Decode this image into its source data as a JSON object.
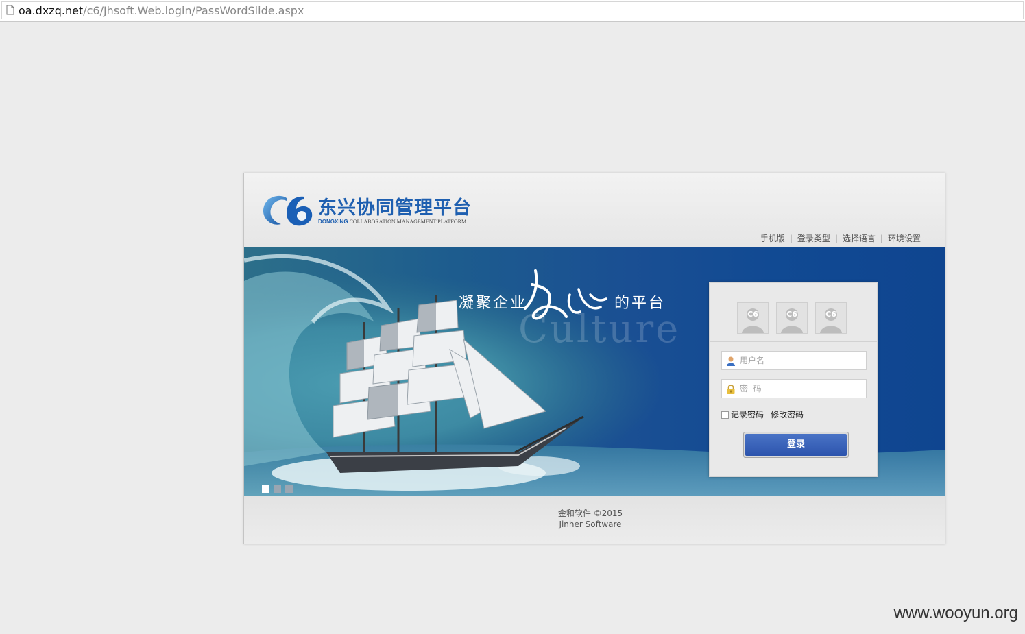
{
  "browser": {
    "url_host": "oa.dxzq.net",
    "url_path": "/c6/Jhsoft.Web.login/PassWordSlide.aspx"
  },
  "brand": {
    "logo_text": "C6",
    "title": "东兴协同管理平台",
    "subtitle_lead": "DONGXING",
    "subtitle_rest": " COLLABORATION MANAGEMENT PLATFORM"
  },
  "top_links": [
    "手机版",
    "登录类型",
    "选择语言",
    "环境设置"
  ],
  "banner": {
    "slogan_left": "凝聚企业",
    "slogan_script": "文化",
    "slogan_right": "的平台",
    "culture_word": "Culture",
    "slide_count": 3,
    "active_slide": 1
  },
  "login": {
    "username_placeholder": "用户名",
    "password_placeholder": "密  码",
    "remember_label": "记录密码",
    "change_password_label": "修改密码",
    "submit_label": "登录"
  },
  "footer": {
    "copyright": "金和软件 ©2015",
    "company": "Jinher Software"
  },
  "watermark": "www.wooyun.org",
  "colors": {
    "brand_blue": "#1e5fb0",
    "button_blue": "#2c54ad"
  }
}
